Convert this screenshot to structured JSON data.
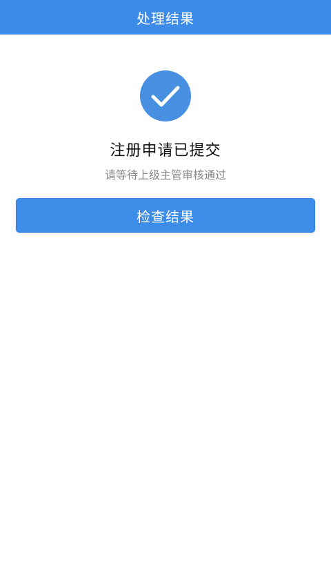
{
  "header": {
    "title": "处理结果"
  },
  "status": {
    "icon": "check-icon",
    "title": "注册申请已提交",
    "subtitle": "请等待上级主管审核通过"
  },
  "actions": {
    "check_result_label": "检查结果"
  },
  "colors": {
    "primary": "#3d8be8",
    "icon_circle": "#478fe0",
    "title_text": "#111111",
    "subtitle_text": "#888888"
  }
}
